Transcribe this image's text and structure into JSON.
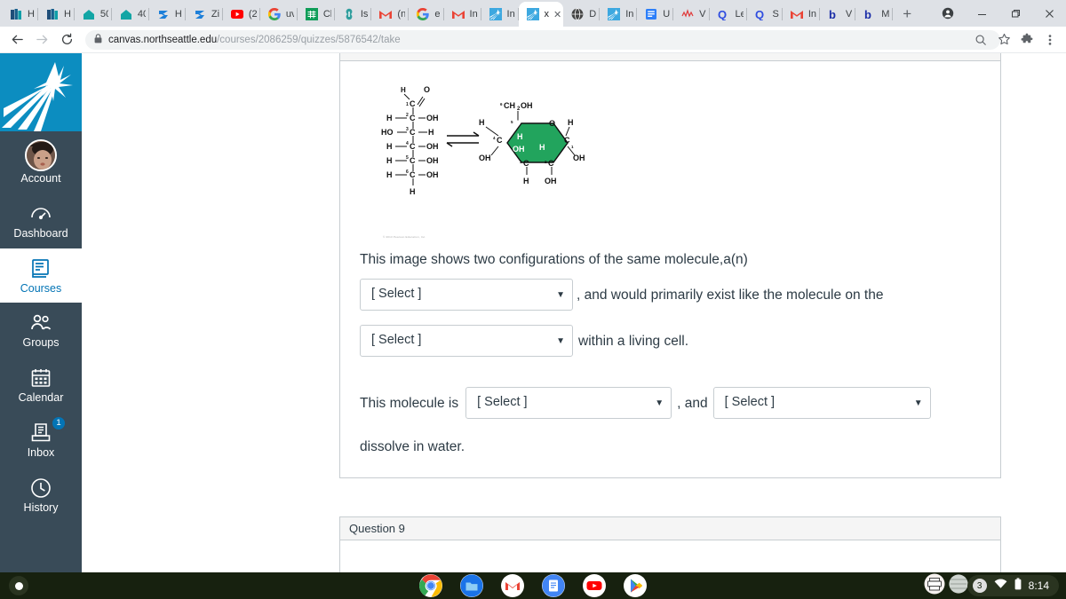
{
  "browser": {
    "tabs": [
      {
        "label": "H",
        "icon": "books-icon",
        "active": false
      },
      {
        "label": "H",
        "icon": "books-icon",
        "active": false
      },
      {
        "label": "50",
        "icon": "home-icon",
        "active": false
      },
      {
        "label": "40",
        "icon": "home-icon",
        "active": false
      },
      {
        "label": "H",
        "icon": "z-logo-icon",
        "active": false
      },
      {
        "label": "Zi",
        "icon": "z-logo-icon",
        "active": false
      },
      {
        "label": "(2",
        "icon": "youtube-icon",
        "active": false
      },
      {
        "label": "uv",
        "icon": "google-icon",
        "active": false
      },
      {
        "label": "Cl",
        "icon": "sheets-icon",
        "active": false
      },
      {
        "label": "Is",
        "icon": "globe-link-icon",
        "active": false
      },
      {
        "label": "(n",
        "icon": "gmail-icon",
        "active": false
      },
      {
        "label": "e",
        "icon": "google-icon",
        "active": false
      },
      {
        "label": "In",
        "icon": "gmail-icon",
        "active": false
      },
      {
        "label": "In",
        "icon": "canvas-star-icon",
        "active": false
      },
      {
        "label": "x",
        "icon": "canvas-star-icon",
        "active": true
      },
      {
        "label": "D",
        "icon": "globe-dark-icon",
        "active": false
      },
      {
        "label": "In",
        "icon": "canvas-star-icon",
        "active": false
      },
      {
        "label": "U",
        "icon": "doc-blue-icon",
        "active": false
      },
      {
        "label": "V",
        "icon": "scribble-red-icon",
        "active": false
      },
      {
        "label": "Le",
        "icon": "quizlet-icon",
        "active": false
      },
      {
        "label": "S",
        "icon": "quizlet-icon",
        "active": false
      },
      {
        "label": "In",
        "icon": "gmail-icon",
        "active": false
      },
      {
        "label": "V",
        "icon": "brainly-b-icon",
        "active": false
      },
      {
        "label": "M",
        "icon": "brainly-b-icon",
        "active": false
      }
    ],
    "new_tab_label": "+",
    "window_controls": {
      "profile": "profile-avatar-icon",
      "minimize": "minimize-icon",
      "maximize": "restore-icon",
      "close": "close-icon"
    },
    "toolbar": {
      "back": "back-arrow-icon",
      "forward": "forward-arrow-icon",
      "reload": "reload-icon",
      "lock": "lock-icon",
      "url_host": "canvas.northseattle.edu",
      "url_path": "/courses/2086259/quizzes/5876542/take",
      "search_icon": "search-icon",
      "bookmark_icon": "star-icon",
      "extensions_icon": "puzzle-icon",
      "menu_icon": "three-dot-menu-icon"
    }
  },
  "global_nav": {
    "logo_alt": "north-seattle-college-logo",
    "items": [
      {
        "label": "Account",
        "icon": "avatar-icon",
        "selected": false,
        "badge": null
      },
      {
        "label": "Dashboard",
        "icon": "dashboard-gauge-icon",
        "selected": false,
        "badge": null
      },
      {
        "label": "Courses",
        "icon": "courses-book-icon",
        "selected": true,
        "badge": null
      },
      {
        "label": "Groups",
        "icon": "groups-people-icon",
        "selected": false,
        "badge": null
      },
      {
        "label": "Calendar",
        "icon": "calendar-icon",
        "selected": false,
        "badge": null
      },
      {
        "label": "Inbox",
        "icon": "inbox-tray-icon",
        "selected": false,
        "badge": "1"
      },
      {
        "label": "History",
        "icon": "history-clock-icon",
        "selected": false,
        "badge": null
      }
    ]
  },
  "quiz": {
    "figure": {
      "alt": "glucose-linear-and-ring-configurations",
      "credit": "© 2013 Pearson Education, Inc.",
      "linear_labels": [
        "H",
        "O",
        "C",
        "1",
        "H",
        "C",
        "OH",
        "2",
        "HO",
        "C",
        "H",
        "3",
        "H",
        "C",
        "OH",
        "4",
        "H",
        "C",
        "OH",
        "5",
        "H",
        "C",
        "OH",
        "6",
        "H"
      ],
      "ring_labels": [
        "CH2OH",
        "6",
        "C",
        "5",
        "O",
        "H",
        "H",
        "C",
        "1",
        "OH",
        "C",
        "4",
        "H",
        "OH",
        "OH",
        "C",
        "3",
        "H",
        "C",
        "2",
        "OH",
        "H",
        "H"
      ],
      "ring_color": "#22a45d",
      "equilibrium_symbol": "double-half-arrow"
    },
    "question_1": {
      "line1": "This image shows two configurations of the same molecule,a(n)",
      "select1": "[ Select ]",
      "after_select1": ", and would primarily exist like the molecule on the",
      "select2": "[ Select ]",
      "after_select2": "within a living cell."
    },
    "question_2": {
      "before": "This molecule  is",
      "select1": "[ Select ]",
      "between": ", and",
      "select2": "[ Select ]",
      "after": "dissolve in water."
    },
    "next_question_header": "Question 9"
  },
  "shelf": {
    "launcher": "launcher-icon",
    "apps": [
      {
        "name": "chrome-icon",
        "open": true
      },
      {
        "name": "files-icon",
        "open": false
      },
      {
        "name": "gmail-icon",
        "open": false
      },
      {
        "name": "docs-icon",
        "open": false
      },
      {
        "name": "youtube-icon",
        "open": true
      },
      {
        "name": "play-store-icon",
        "open": false
      }
    ],
    "status": {
      "notification_count": "3",
      "wifi_icon": "wifi-icon",
      "battery_icon": "battery-icon",
      "time": "8:14"
    }
  },
  "colors": {
    "canvas_blue": "#0374b5",
    "nav_dark": "#394b58",
    "logo_blue": "#0c8dc0",
    "molecule_green": "#22a45d",
    "shelf_dark": "#17210f"
  }
}
